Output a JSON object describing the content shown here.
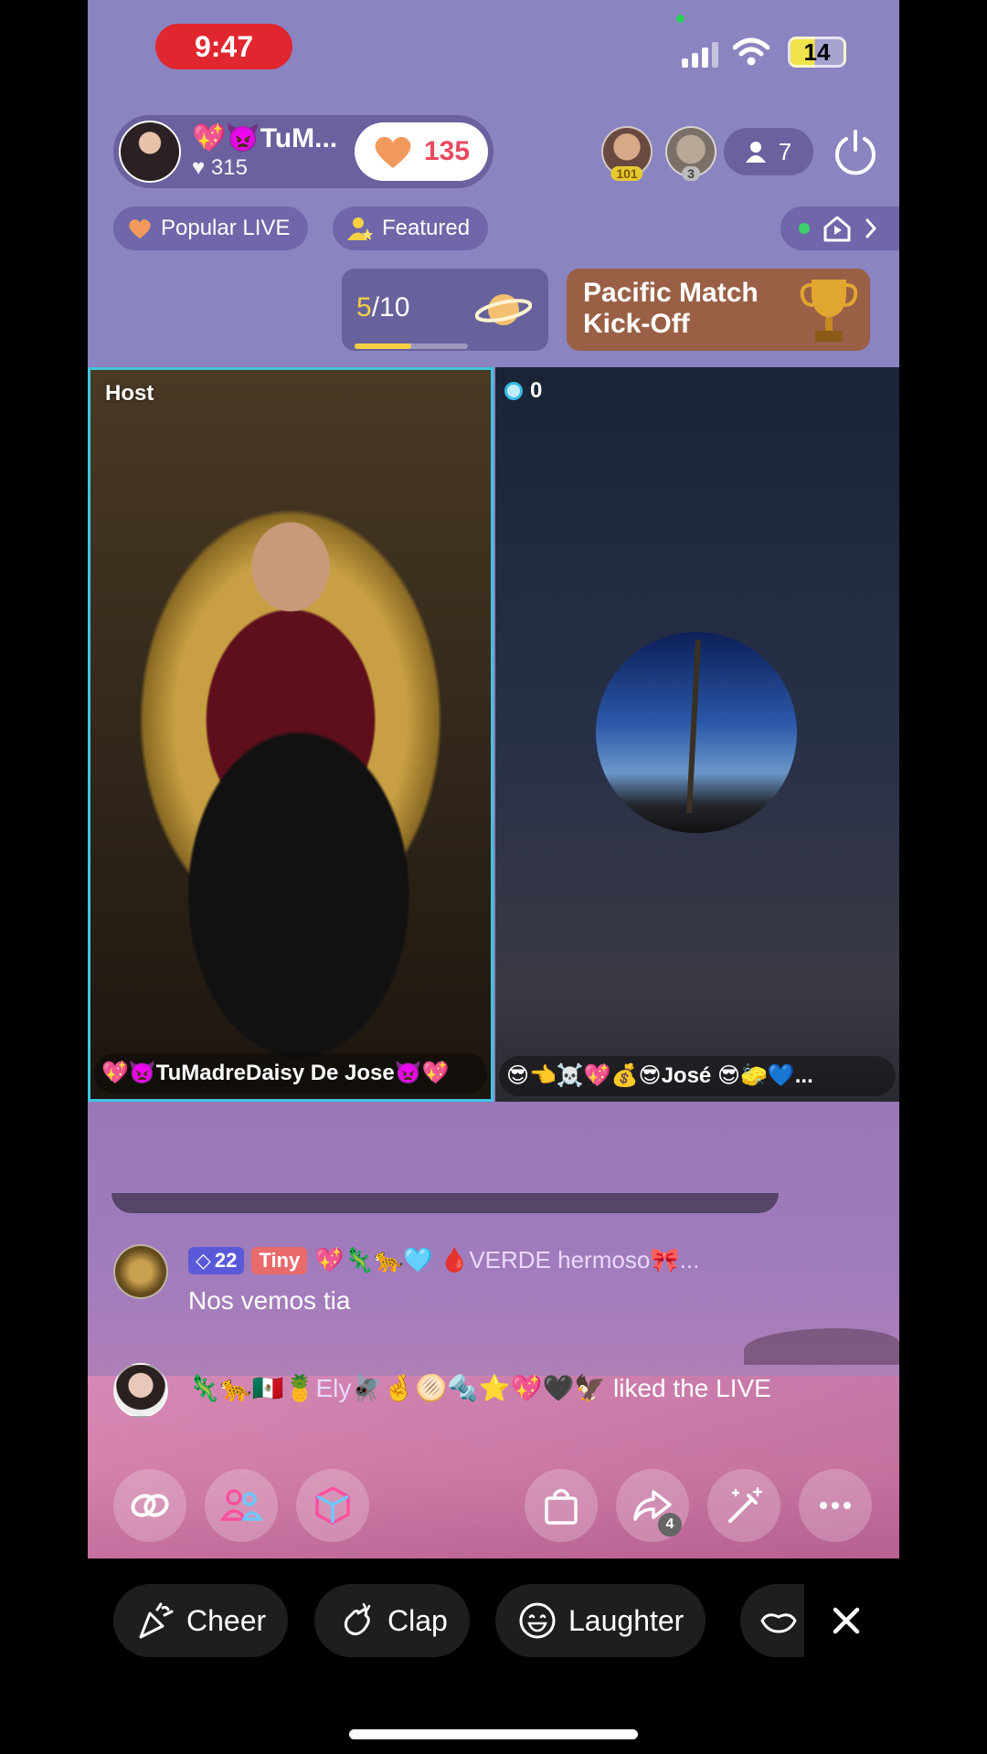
{
  "status_bar": {
    "time": "9:47",
    "battery": "14"
  },
  "host": {
    "name": "💖👿TuM...",
    "likes": "315",
    "follow_count": "135"
  },
  "viewers": {
    "avatar1_badge": "101",
    "avatar2_badge": "3",
    "count": "7"
  },
  "tags": [
    {
      "label": "Popular LIVE",
      "icon": "heart-icon"
    },
    {
      "label": "Featured",
      "icon": "person-star-icon"
    }
  ],
  "goal": {
    "current": "5",
    "total": "/10",
    "progress": 0.5
  },
  "match": {
    "title_line1": "Pacific Match",
    "title_line2": "Kick-Off",
    "icon": "trophy-icon"
  },
  "battle": {
    "host_label": "Host",
    "host_name": "💖👿TuMadreDaisy De Jose👿💖",
    "guest_score": "0",
    "guest_name": "😎👈☠️💖💰😎José 😎🧽💙..."
  },
  "chat": [
    {
      "level": "22",
      "tag": "Tiny",
      "name": "💖🦎🐆🩵 🩸VERDE hermoso🎀...",
      "text": "Nos vemos tia"
    },
    {
      "name": "🦎🐆🇲🇽🍍Ely🪰🤞🫓🔩⭐💖🖤🦅",
      "text": "liked the LIVE"
    }
  ],
  "actions": {
    "share_count": "4",
    "buttons": [
      "link-icon",
      "multi-guest-icon",
      "cube-icon",
      "shopping-bag-icon",
      "share-icon",
      "magic-wand-icon",
      "more-icon"
    ]
  },
  "reactions": [
    {
      "label": "Cheer",
      "icon": "party-icon"
    },
    {
      "label": "Clap",
      "icon": "clap-icon"
    },
    {
      "label": "Laughter",
      "icon": "laugh-icon"
    }
  ],
  "colors": {
    "accent_pink": "#e84a5f",
    "goal_yellow": "#f5d042",
    "host_border": "#3ec6e0",
    "time_red": "#e0262f"
  }
}
